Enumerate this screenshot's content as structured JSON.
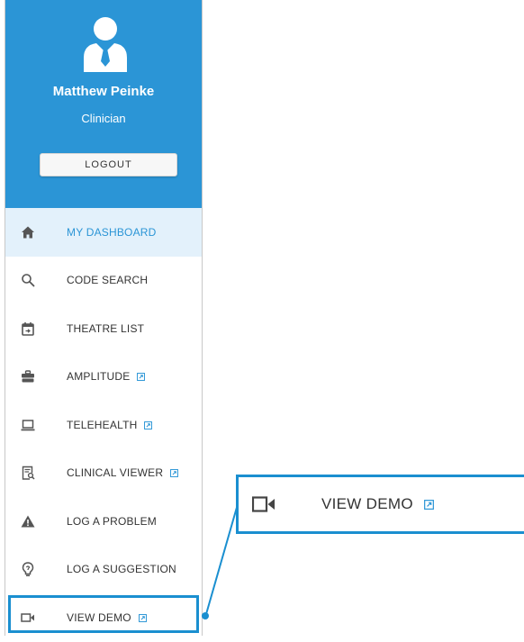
{
  "profile": {
    "name": "Matthew Peinke",
    "role": "Clinician",
    "logout_label": "LOGOUT"
  },
  "nav": {
    "items": [
      {
        "label": "MY DASHBOARD",
        "icon": "home-icon",
        "active": true,
        "external": false
      },
      {
        "label": "CODE SEARCH",
        "icon": "search-icon",
        "active": false,
        "external": false
      },
      {
        "label": "THEATRE LIST",
        "icon": "calendar-icon",
        "active": false,
        "external": false
      },
      {
        "label": "AMPLITUDE",
        "icon": "briefcase-icon",
        "active": false,
        "external": true
      },
      {
        "label": "TELEHEALTH",
        "icon": "laptop-icon",
        "active": false,
        "external": true
      },
      {
        "label": "CLINICAL VIEWER",
        "icon": "document-search-icon",
        "active": false,
        "external": true
      },
      {
        "label": "LOG A PROBLEM",
        "icon": "warning-icon",
        "active": false,
        "external": false
      },
      {
        "label": "LOG A SUGGESTION",
        "icon": "lightbulb-icon",
        "active": false,
        "external": false
      },
      {
        "label": "VIEW DEMO",
        "icon": "video-camera-icon",
        "active": false,
        "external": true
      }
    ]
  },
  "callout": {
    "label": "VIEW DEMO",
    "icon": "video-camera-icon"
  },
  "colors": {
    "brand": "#2b95d6",
    "active_bg": "#e3f1fb",
    "highlight": "#1a8fd0",
    "icon": "#555555"
  }
}
